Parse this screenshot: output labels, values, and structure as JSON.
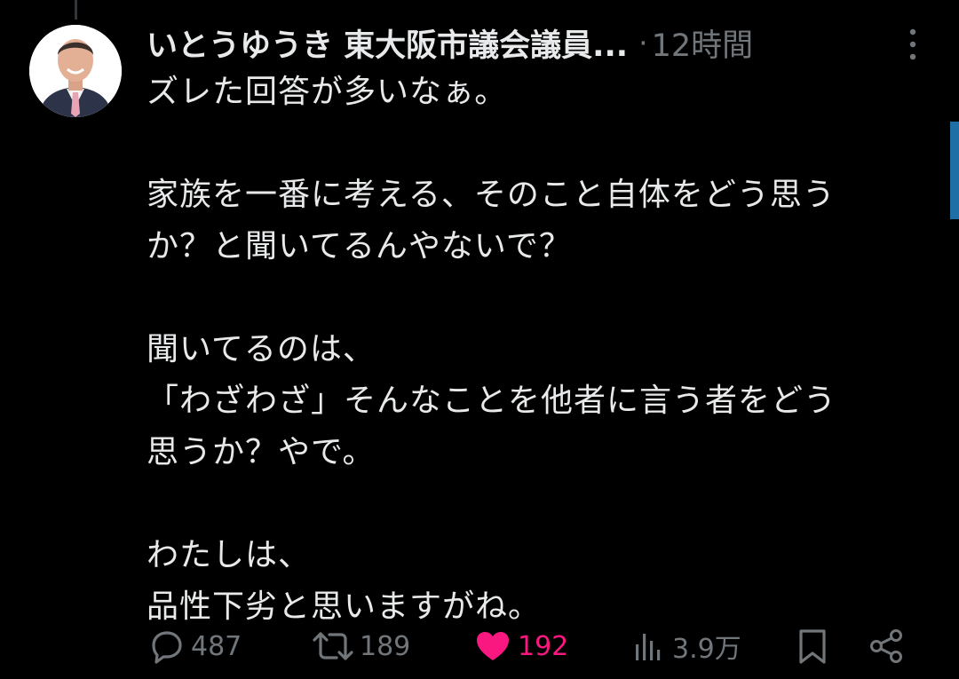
{
  "post": {
    "author_name": "いとうゆうき 東大阪市議会議員...",
    "separator": "·",
    "timestamp": "12時間",
    "lines": [
      "ズレた回答が多いなぁ。",
      "",
      "家族を一番に考える、そのこと自体をどう思う",
      "か？と聞いてるんやないで？",
      "",
      "聞いてるのは、",
      "「わざわざ」そんなことを他者に言う者をどう",
      "思うか？やで。",
      "",
      "わたしは、",
      "品性下劣と思いますがね。"
    ]
  },
  "actions": {
    "reply": {
      "icon": "reply-icon",
      "count": "487"
    },
    "repost": {
      "icon": "repost-icon",
      "count": "189"
    },
    "like": {
      "icon": "heart-icon",
      "count": "192",
      "active": true
    },
    "views": {
      "icon": "views-icon",
      "count": "3.9万"
    },
    "bookmark": {
      "icon": "bookmark-icon"
    },
    "share": {
      "icon": "share-icon"
    }
  },
  "colors": {
    "background": "#000000",
    "text": "#e7e9ea",
    "muted": "#71767b",
    "like_active": "#f91880",
    "scroll_indicator": "#1d6fa5"
  }
}
